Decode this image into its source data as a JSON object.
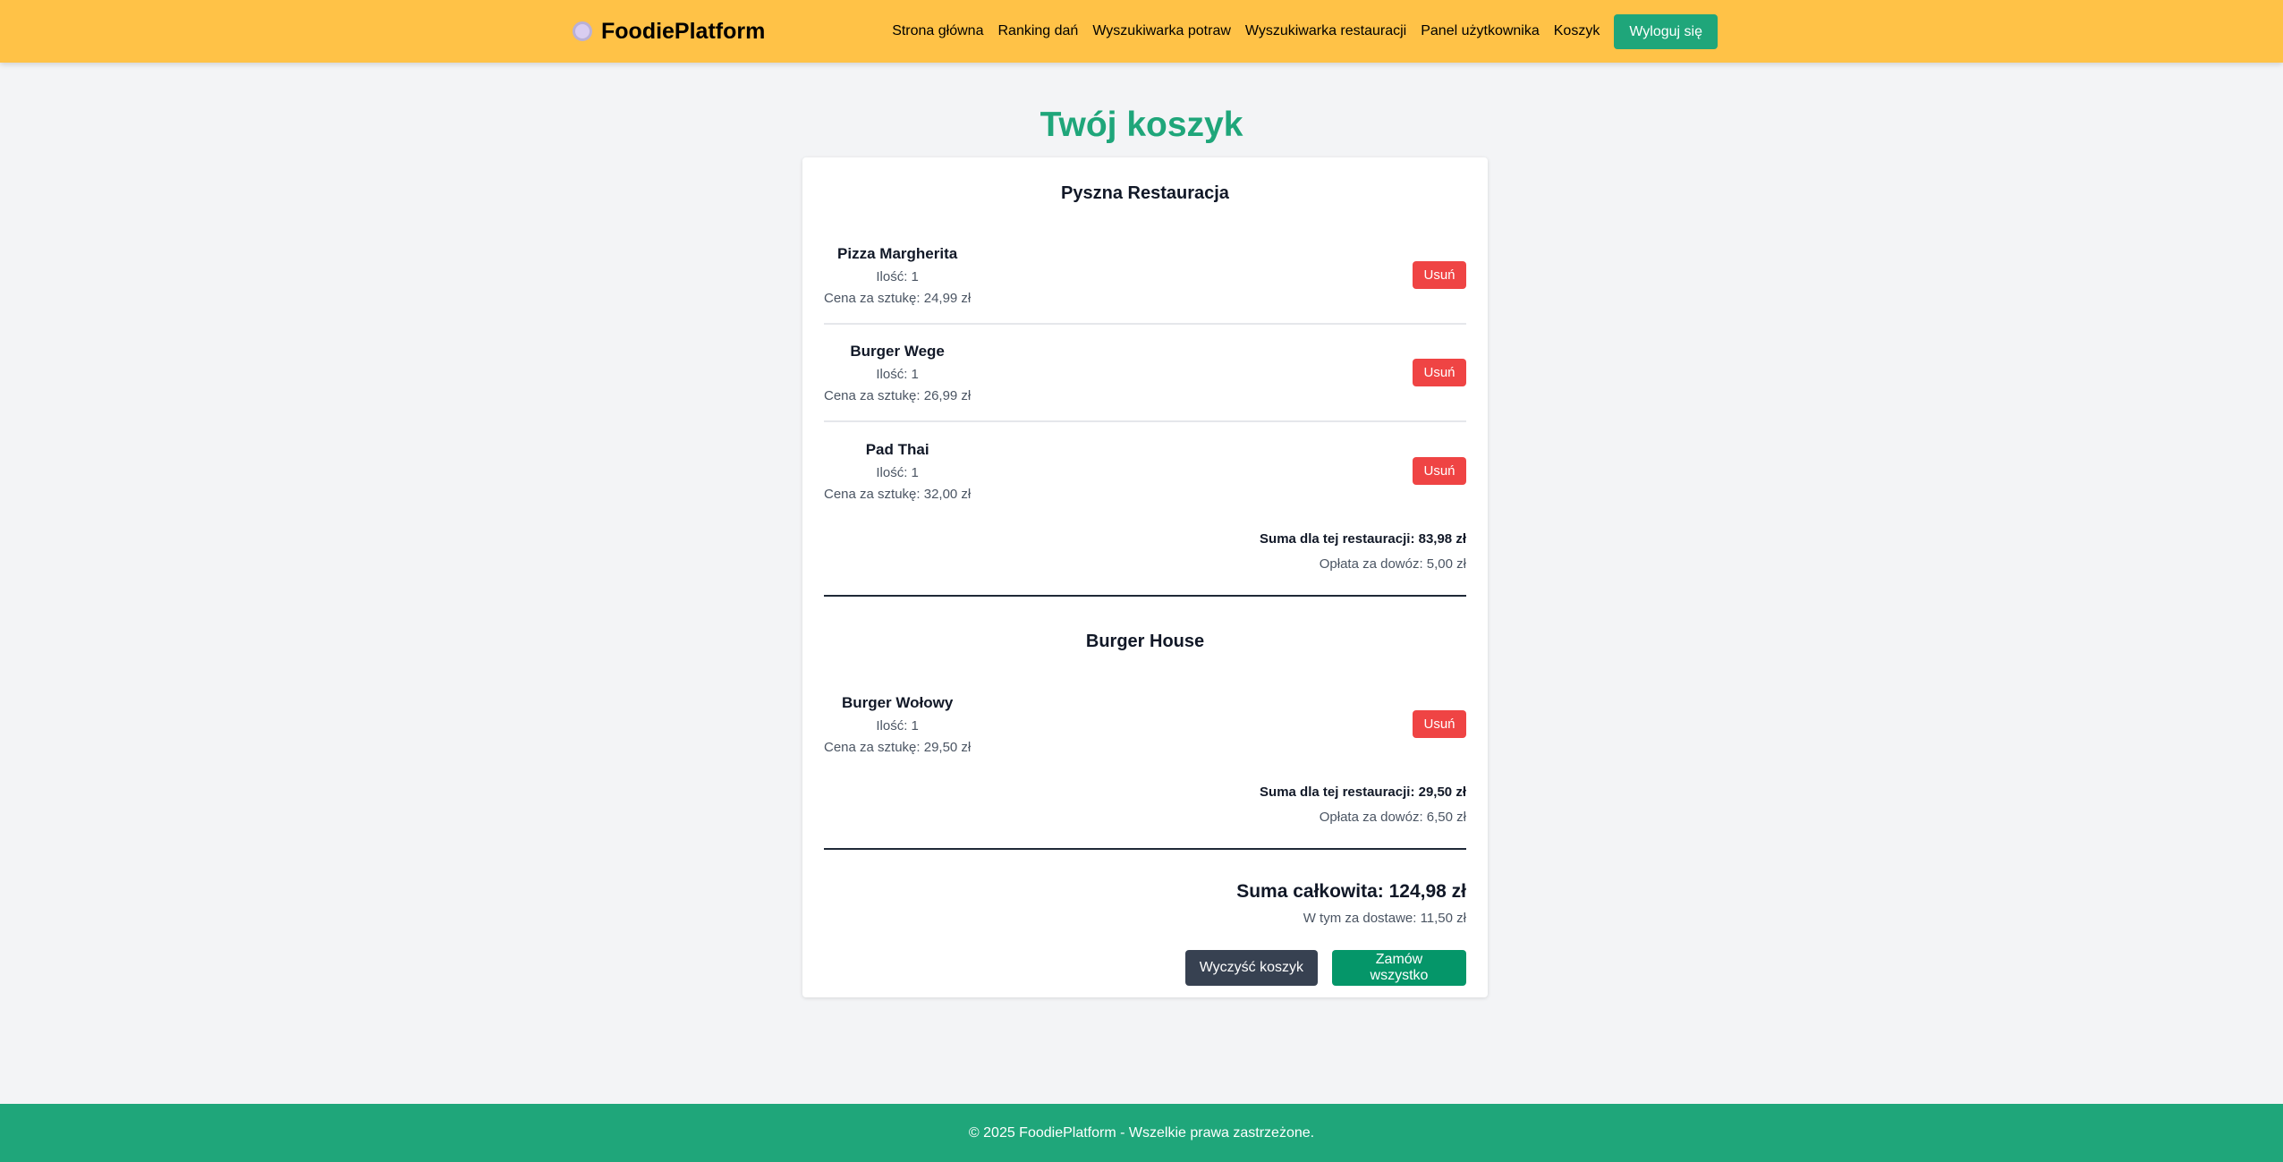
{
  "header": {
    "logo": "FoodiePlatform",
    "nav": [
      "Strona główna",
      "Ranking dań",
      "Wyszukiwarka potraw",
      "Wyszukiwarka restauracji",
      "Panel użytkownika",
      "Koszyk"
    ],
    "logout": "Wyloguj się"
  },
  "title": "Twój koszyk",
  "restaurants": [
    {
      "name": "Pyszna Restauracja",
      "items": [
        {
          "name": "Pizza Margherita",
          "qty": "Ilość: 1",
          "price": "Cena za sztukę: 24,99 zł"
        },
        {
          "name": "Burger Wege",
          "qty": "Ilość: 1",
          "price": "Cena za sztukę: 26,99 zł"
        },
        {
          "name": "Pad Thai",
          "qty": "Ilość: 1",
          "price": "Cena za sztukę: 32,00 zł"
        }
      ],
      "sum": "Suma dla tej restauracji: 83,98 zł",
      "fee": "Opłata za dowóz: 5,00 zł"
    },
    {
      "name": "Burger House",
      "items": [
        {
          "name": "Burger Wołowy",
          "qty": "Ilość: 1",
          "price": "Cena za sztukę: 29,50 zł"
        }
      ],
      "sum": "Suma dla tej restauracji: 29,50 zł",
      "fee": "Opłata za dowóz: 6,50 zł"
    }
  ],
  "remove_label": "Usuń",
  "total": "Suma całkowita: 124,98 zł",
  "delivery_total": "W tym za dostawe: 11,50 zł",
  "clear_label": "Wyczyść koszyk",
  "order_label": "Zamów wszystko",
  "footer": "© 2025 FoodiePlatform - Wszelkie prawa zastrzeżone.",
  "colors": {
    "header": "#ffc247",
    "accent": "#1fa67a",
    "danger": "#ef4444",
    "dark": "#374151",
    "order": "#059669"
  }
}
